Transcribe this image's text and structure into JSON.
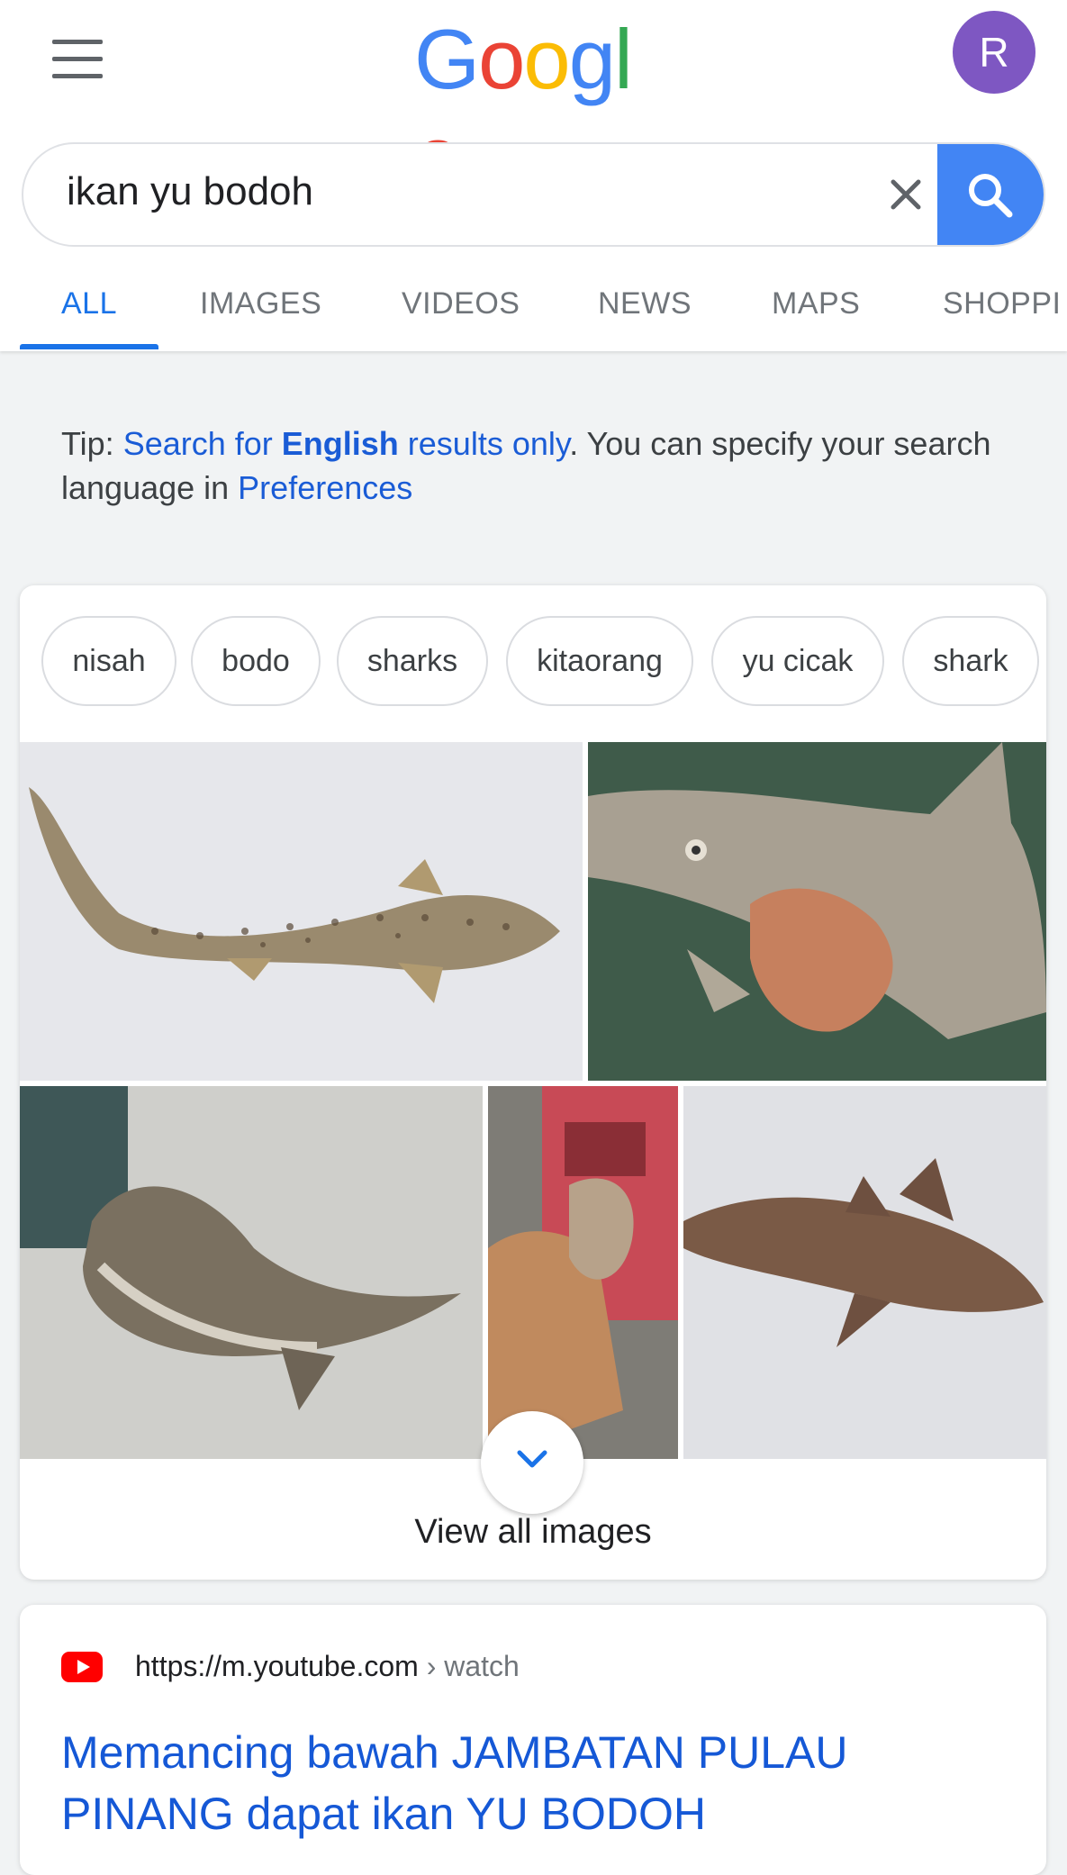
{
  "header": {
    "logo_text": "Google",
    "logo_colors": [
      "#4285f4",
      "#ea4335",
      "#fbbc05",
      "#4285f4",
      "#34a853",
      "#ea4335"
    ],
    "avatar_letter": "R",
    "avatar_color": "#7e57c2"
  },
  "search": {
    "query": "ikan yu bodoh",
    "clear_icon": "close-icon",
    "search_icon": "search-icon"
  },
  "tabs": [
    {
      "label": "ALL",
      "active": true
    },
    {
      "label": "IMAGES"
    },
    {
      "label": "VIDEOS"
    },
    {
      "label": "NEWS"
    },
    {
      "label": "MAPS"
    },
    {
      "label": "SHOPPI"
    }
  ],
  "tip": {
    "prefix": "Tip: ",
    "link1_part1": "Search for ",
    "link1_bold": "English",
    "link1_part2": " results only",
    "middle": ". You can specify your search language in ",
    "link2": "Preferences"
  },
  "images": {
    "chips": [
      "nisah",
      "bodo",
      "sharks",
      "kitaorang",
      "yu cicak",
      "shark"
    ],
    "photo_descriptions_hidden": false,
    "view_all_label": "View all images"
  },
  "result": {
    "site_icon": "youtube-icon",
    "url": "https://m.youtube.com",
    "breadcrumb": " › watch",
    "title": "Memancing bawah JAMBATAN PULAU PINANG dapat ikan YU BODOH"
  }
}
